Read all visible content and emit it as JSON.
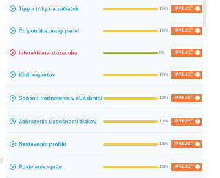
{
  "items": [
    {
      "title": "Tipy a triky na začiatok",
      "progress": 100,
      "percent_label": "100%",
      "status": "ok",
      "button_label": "PREJSŤ"
    },
    {
      "title": "Čo ponúka pravý panel",
      "progress": 100,
      "percent_label": "100%",
      "status": "ok",
      "button_label": "PREJSŤ"
    },
    {
      "title": "Interaktívna zoznamka",
      "progress": 100,
      "percent_label": "0%",
      "status": "warn",
      "button_label": "PREJSŤ"
    },
    {
      "title": "Klub expertov",
      "progress": 100,
      "percent_label": "100%",
      "status": "ok",
      "button_label": "PREJSŤ"
    },
    {
      "title": "Spôsob hodnotenia v eUčebnici",
      "progress": 100,
      "percent_label": "100%",
      "status": "ok",
      "button_label": "PREJSŤ"
    },
    {
      "title": "Zobrazenie úspešnosti žiakov",
      "progress": 100,
      "percent_label": "100%",
      "status": "ok",
      "button_label": "PREJSŤ"
    },
    {
      "title": "Nastavenie profilu",
      "progress": 100,
      "percent_label": "100%",
      "status": "ok",
      "button_label": "PREJSŤ"
    },
    {
      "title": "Posielanie správ",
      "progress": 100,
      "percent_label": "100%",
      "status": "ok",
      "button_label": "PREJSŤ"
    }
  ],
  "colors": {
    "progress_complete": "#efc955",
    "progress_special": "#98b04a",
    "button": "#f47a3e",
    "title_ok": "#2da6cf",
    "title_warn": "#e04a5a"
  },
  "icons": {
    "ok": "info-circle-icon",
    "warn": "alert-circle-icon",
    "button": "arrow-right-circle-icon"
  }
}
